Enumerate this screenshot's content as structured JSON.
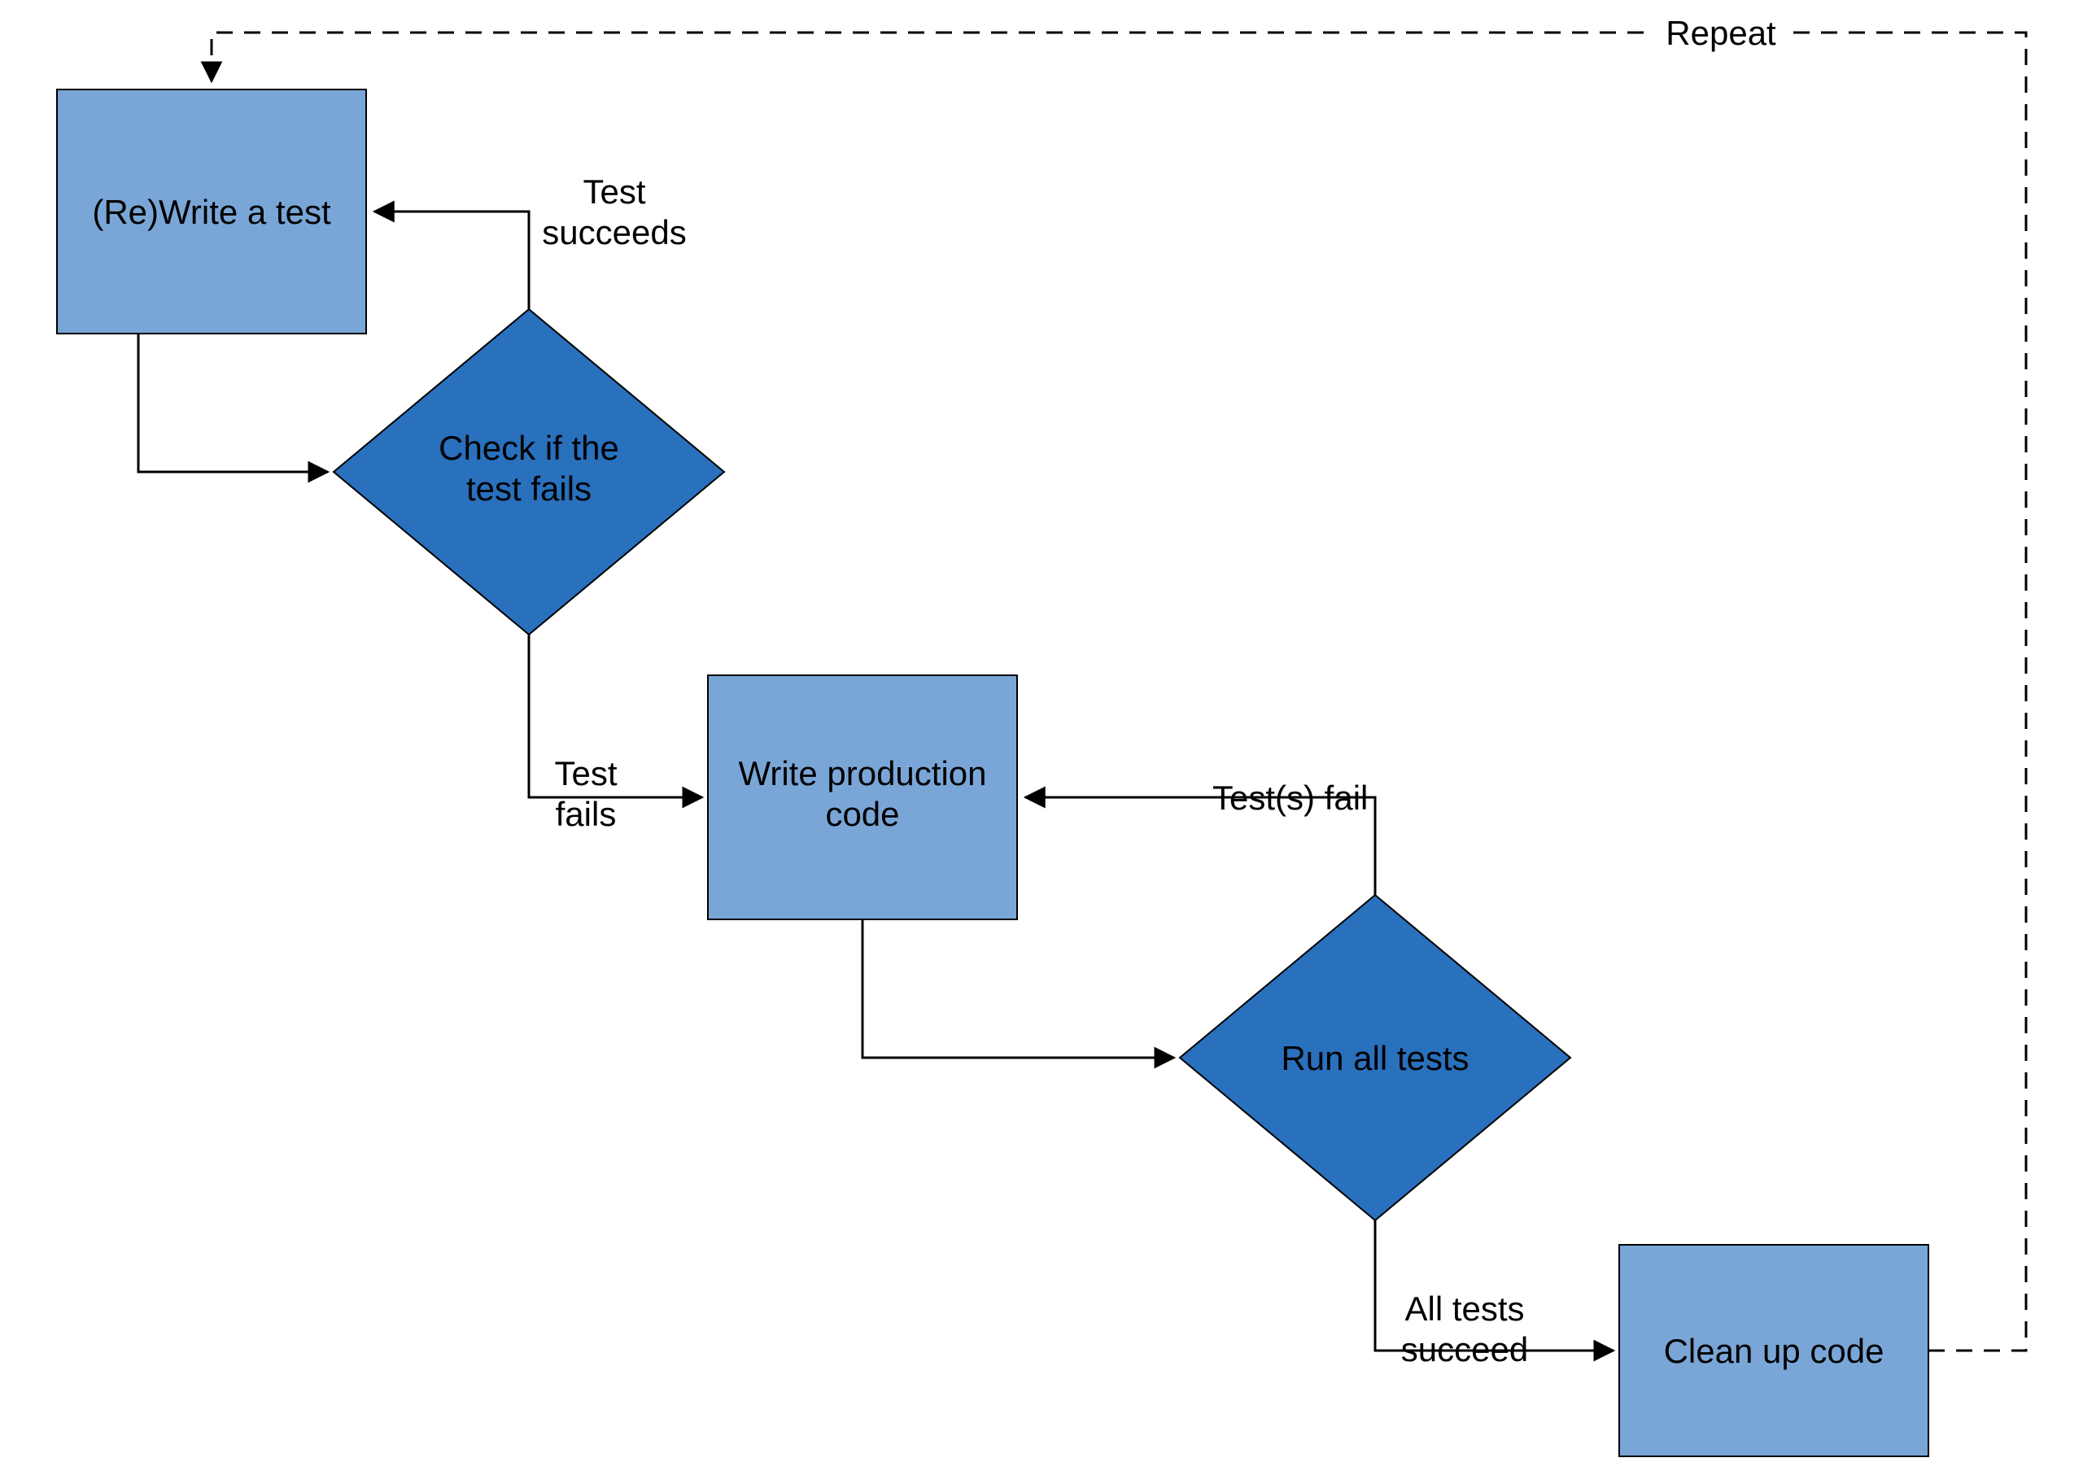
{
  "nodes": {
    "write_test": {
      "line1": "(Re)Write a test"
    },
    "check_fails": {
      "line1": "Check if the",
      "line2": "test fails"
    },
    "write_prod": {
      "line1": "Write production",
      "line2": "code"
    },
    "run_all": {
      "line1": "Run all tests"
    },
    "clean_up": {
      "line1": "Clean up code"
    }
  },
  "edges": {
    "test_succeeds": {
      "line1": "Test",
      "line2": "succeeds"
    },
    "test_fails": {
      "line1": "Test",
      "line2": "fails"
    },
    "tests_fail": {
      "line1": "Test(s) fail"
    },
    "all_succeed": {
      "line1": "All tests",
      "line2": "succeed"
    },
    "repeat": {
      "line1": "Repeat"
    }
  },
  "colors": {
    "box_light": "#7aa6d7",
    "diamond_dark": "#2970bd",
    "stroke": "#000000"
  }
}
